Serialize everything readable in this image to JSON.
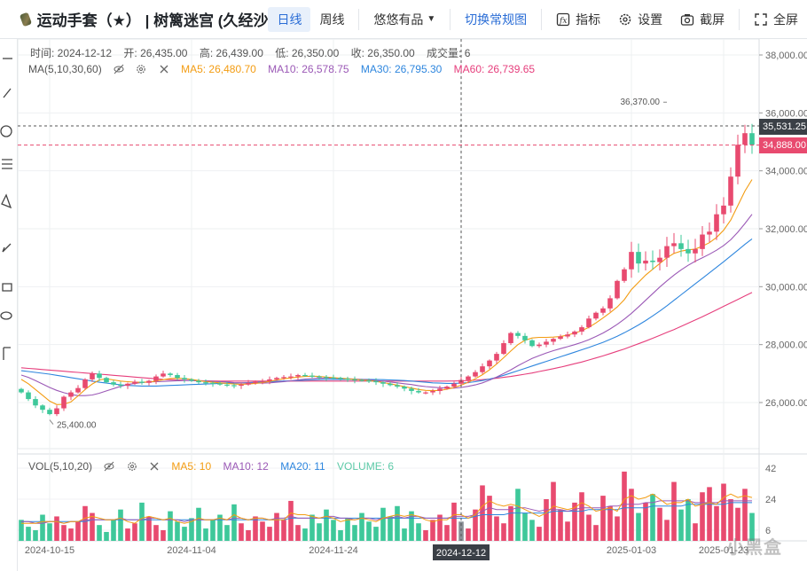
{
  "header": {
    "title": "运动手套（★） | 树篱迷宫 (久经沙",
    "tabs": [
      {
        "label": "日线",
        "active": true
      },
      {
        "label": "周线",
        "active": false
      }
    ],
    "filter_label": "悠悠有品",
    "switch_label": "切换常规图",
    "indicator_label": "指标",
    "settings_label": "设置",
    "screenshot_label": "截屏",
    "fullscreen_label": "全屏"
  },
  "info": {
    "time": "时间: 2024-12-12",
    "open": "开: 26,435.00",
    "high": "高: 26,439.00",
    "low": "低: 26,350.00",
    "close": "收: 26,350.00",
    "volume": "成交量: 6"
  },
  "ma_legend": {
    "name": "MA(5,10,30,60)",
    "ma5": "MA5: 26,480.70",
    "ma10": "MA10: 26,578.75",
    "ma30": "MA30: 26,795.30",
    "ma60": "MA60: 26,739.65"
  },
  "vol_legend": {
    "name": "VOL(5,10,20)",
    "ma5": "MA5: 10",
    "ma10": "MA10: 12",
    "ma20": "MA20: 11",
    "volume": "VOLUME: 6"
  },
  "price_tags": {
    "crosshair": "35,531.25",
    "last": "34,888.00"
  },
  "watermark": "小黑盒",
  "colors": {
    "up": "#e84a6f",
    "down": "#3ec89a",
    "ma5": "#f39c12",
    "ma10": "#9b59b6",
    "ma30": "#2e86de",
    "ma60": "#e63e7c"
  },
  "chart_data": [
    {
      "type": "candlestick",
      "title": "",
      "ylim": [
        24500,
        38500
      ],
      "y_ticks": [
        "38,000.00",
        "36,000.00",
        "34,000.00",
        "32,000.00",
        "30,000.00",
        "28,000.00",
        "26,000.00"
      ],
      "x_labels": [
        "2024-10-15",
        "2024-11-04",
        "2024-11-24",
        "2024-12-12",
        "2025-01-03",
        "2025-01-23"
      ],
      "crosshair_date": "2024-12-12",
      "annotations": [
        {
          "text": "36,370.00",
          "date_index": 91,
          "value": 36370
        },
        {
          "text": "25,400.00",
          "date_index": 4,
          "value": 25400
        }
      ],
      "close": [
        26350,
        26120,
        25900,
        25750,
        25600,
        25800,
        26200,
        26350,
        26500,
        26800,
        27000,
        26850,
        26700,
        26620,
        26580,
        26650,
        26720,
        26680,
        26750,
        26900,
        27000,
        26950,
        26850,
        26800,
        26750,
        26700,
        26680,
        26660,
        26620,
        26600,
        26580,
        26620,
        26680,
        26720,
        26750,
        26800,
        26850,
        26880,
        26900,
        26950,
        26930,
        26900,
        26880,
        26860,
        26850,
        26820,
        26800,
        26780,
        26760,
        26740,
        26700,
        26650,
        26600,
        26550,
        26480,
        26400,
        26350,
        26350,
        26400,
        26480,
        26550,
        26650,
        26780,
        26900,
        27050,
        27250,
        27450,
        27680,
        28050,
        28400,
        28300,
        28150,
        27950,
        28000,
        28100,
        28200,
        28280,
        28350,
        28450,
        28600,
        28900,
        29100,
        29250,
        29600,
        30200,
        30600,
        31200,
        30800,
        30900,
        30850,
        31000,
        31400,
        31500,
        31300,
        31150,
        31300,
        31800,
        31900,
        32500,
        32800,
        33800,
        34900,
        35300,
        34900
      ],
      "ma5": [
        26800,
        26650,
        26450,
        26250,
        26050,
        25930,
        25940,
        26020,
        26230,
        26450,
        26640,
        26780,
        26820,
        26780,
        26740,
        26720,
        26700,
        26700,
        26710,
        26740,
        26790,
        26830,
        26840,
        26830,
        26800,
        26760,
        26720,
        26700,
        26680,
        26660,
        26640,
        26630,
        26640,
        26660,
        26690,
        26730,
        26780,
        26820,
        26850,
        26880,
        26900,
        26910,
        26900,
        26880,
        26860,
        26840,
        26820,
        26800,
        26780,
        26760,
        26730,
        26690,
        26650,
        26600,
        26550,
        26500,
        26450,
        26420,
        26410,
        26420,
        26460,
        26520,
        26600,
        26700,
        26820,
        26960,
        27130,
        27330,
        27550,
        27780,
        28000,
        28150,
        28230,
        28250,
        28250,
        28260,
        28280,
        28330,
        28400,
        28480,
        28600,
        28750,
        28920,
        29100,
        29300,
        29550,
        29900,
        30150,
        30400,
        30600,
        30800,
        31000,
        31150,
        31230,
        31270,
        31300,
        31400,
        31520,
        31700,
        31950,
        32300,
        32800,
        33300,
        33700
      ],
      "ma10": [
        26950,
        26870,
        26760,
        26640,
        26520,
        26420,
        26340,
        26280,
        26240,
        26240,
        26260,
        26320,
        26400,
        26480,
        26560,
        26620,
        26660,
        26690,
        26710,
        26720,
        26730,
        26740,
        26750,
        26760,
        26760,
        26750,
        26740,
        26730,
        26720,
        26710,
        26690,
        26680,
        26670,
        26670,
        26670,
        26680,
        26700,
        26720,
        26750,
        26780,
        26810,
        26830,
        26840,
        26840,
        26840,
        26830,
        26820,
        26810,
        26800,
        26780,
        26760,
        26740,
        26710,
        26680,
        26650,
        26620,
        26580,
        26550,
        26530,
        26510,
        26500,
        26500,
        26520,
        26560,
        26610,
        26680,
        26770,
        26880,
        27000,
        27130,
        27270,
        27400,
        27520,
        27620,
        27710,
        27790,
        27860,
        27930,
        28000,
        28080,
        28170,
        28280,
        28400,
        28540,
        28700,
        28880,
        29080,
        29300,
        29530,
        29760,
        29990,
        30200,
        30400,
        30580,
        30740,
        30880,
        31000,
        31120,
        31260,
        31420,
        31620,
        31880,
        32180,
        32500
      ],
      "ma30": [
        27100,
        27070,
        27040,
        27010,
        26980,
        26940,
        26900,
        26860,
        26820,
        26780,
        26740,
        26700,
        26670,
        26640,
        26610,
        26590,
        26580,
        26570,
        26570,
        26570,
        26580,
        26590,
        26600,
        26610,
        26620,
        26630,
        26640,
        26650,
        26660,
        26670,
        26670,
        26680,
        26690,
        26700,
        26710,
        26720,
        26730,
        26740,
        26750,
        26760,
        26770,
        26780,
        26790,
        26795,
        26800,
        26800,
        26800,
        26800,
        26800,
        26800,
        26795,
        26790,
        26780,
        26770,
        26760,
        26740,
        26720,
        26700,
        26680,
        26670,
        26660,
        26660,
        26670,
        26690,
        26720,
        26760,
        26810,
        26870,
        26940,
        27020,
        27100,
        27180,
        27260,
        27340,
        27420,
        27500,
        27580,
        27660,
        27740,
        27820,
        27900,
        27990,
        28080,
        28180,
        28290,
        28410,
        28540,
        28680,
        28830,
        28990,
        29160,
        29340,
        29530,
        29720,
        29910,
        30100,
        30290,
        30480,
        30670,
        30860,
        31060,
        31260,
        31460,
        31650
      ],
      "ma60": [
        27200,
        27180,
        27160,
        27140,
        27120,
        27100,
        27080,
        27060,
        27040,
        27020,
        27000,
        26980,
        26960,
        26940,
        26920,
        26900,
        26880,
        26860,
        26840,
        26820,
        26800,
        26790,
        26780,
        26770,
        26760,
        26755,
        26750,
        26745,
        26740,
        26740,
        26740,
        26740,
        26740,
        26740,
        26740,
        26740,
        26740,
        26740,
        26740,
        26740,
        26740,
        26740,
        26740,
        26740,
        26740,
        26740,
        26740,
        26740,
        26740,
        26740,
        26740,
        26740,
        26740,
        26740,
        26740,
        26740,
        26740,
        26740,
        26740,
        26740,
        26740,
        26745,
        26750,
        26760,
        26770,
        26790,
        26810,
        26840,
        26870,
        26900,
        26940,
        26980,
        27020,
        27070,
        27120,
        27170,
        27220,
        27280,
        27340,
        27400,
        27470,
        27540,
        27610,
        27690,
        27770,
        27850,
        27940,
        28030,
        28120,
        28220,
        28320,
        28420,
        28520,
        28630,
        28740,
        28850,
        28960,
        29080,
        29200,
        29320,
        29440,
        29560,
        29680,
        29800
      ]
    },
    {
      "type": "bar",
      "title": "",
      "ylim": [
        0,
        48
      ],
      "y_ticks": [
        "42",
        "24",
        "6"
      ],
      "volume": [
        12,
        8,
        6,
        15,
        10,
        14,
        9,
        7,
        11,
        20,
        16,
        9,
        5,
        12,
        18,
        7,
        10,
        22,
        14,
        9,
        6,
        17,
        11,
        8,
        13,
        19,
        7,
        12,
        15,
        9,
        21,
        10,
        6,
        14,
        11,
        8,
        16,
        12,
        23,
        9,
        7,
        15,
        10,
        18,
        12,
        6,
        13,
        9,
        16,
        11,
        8,
        19,
        14,
        20,
        7,
        17,
        10,
        6,
        12,
        15,
        9,
        22,
        11,
        7,
        18,
        32,
        26,
        14,
        10,
        20,
        30,
        16,
        12,
        8,
        24,
        34,
        18,
        11,
        22,
        28,
        15,
        9,
        26,
        20,
        14,
        40,
        30,
        16,
        22,
        27,
        19,
        12,
        34,
        18,
        24,
        10,
        28,
        31,
        20,
        33,
        24,
        19,
        30,
        16
      ],
      "ma5": [
        10,
        10,
        10,
        11,
        11,
        11,
        10,
        11,
        11,
        13,
        14,
        13,
        12,
        12,
        13,
        11,
        10,
        13,
        14,
        13,
        12,
        13,
        11,
        10,
        11,
        13,
        12,
        12,
        13,
        12,
        15,
        13,
        12,
        13,
        13,
        12,
        12,
        12,
        16,
        15,
        15,
        14,
        13,
        14,
        13,
        11,
        12,
        12,
        13,
        12,
        11,
        13,
        14,
        15,
        14,
        15,
        14,
        12,
        11,
        12,
        12,
        15,
        15,
        13,
        15,
        20,
        23,
        21,
        20,
        21,
        20,
        18,
        16,
        14,
        16,
        20,
        19,
        18,
        19,
        22,
        20,
        17,
        18,
        19,
        17,
        24,
        26,
        24,
        25,
        27,
        24,
        21,
        22,
        22,
        24,
        20,
        21,
        22,
        21,
        25,
        27,
        25,
        26,
        25
      ],
      "ma10": [
        11,
        11,
        10,
        10,
        11,
        11,
        10,
        11,
        11,
        12,
        12,
        12,
        12,
        12,
        13,
        12,
        12,
        12,
        13,
        13,
        12,
        12,
        12,
        11,
        12,
        12,
        12,
        12,
        13,
        12,
        13,
        13,
        12,
        13,
        13,
        12,
        13,
        13,
        14,
        13,
        13,
        13,
        13,
        14,
        14,
        13,
        13,
        12,
        13,
        13,
        12,
        13,
        13,
        14,
        13,
        14,
        14,
        13,
        13,
        13,
        13,
        14,
        14,
        14,
        15,
        17,
        19,
        18,
        18,
        18,
        19,
        19,
        18,
        17,
        18,
        18,
        18,
        17,
        18,
        19,
        19,
        19,
        19,
        20,
        20,
        21,
        21,
        21,
        22,
        22,
        23,
        23,
        23,
        23,
        23,
        22,
        22,
        22,
        22,
        23,
        23,
        23,
        23,
        23
      ],
      "ma20": [
        11,
        11,
        11,
        11,
        11,
        11,
        11,
        11,
        11,
        11,
        12,
        12,
        12,
        12,
        12,
        12,
        12,
        12,
        12,
        12,
        12,
        12,
        12,
        12,
        12,
        12,
        12,
        12,
        12,
        12,
        12,
        12,
        12,
        12,
        12,
        12,
        12,
        12,
        13,
        13,
        13,
        13,
        13,
        13,
        13,
        13,
        13,
        13,
        13,
        13,
        13,
        13,
        13,
        13,
        13,
        13,
        13,
        13,
        13,
        13,
        13,
        13,
        13,
        13,
        14,
        15,
        15,
        15,
        15,
        16,
        16,
        16,
        16,
        16,
        16,
        17,
        17,
        17,
        17,
        17,
        18,
        18,
        18,
        18,
        18,
        19,
        19,
        19,
        19,
        20,
        20,
        20,
        20,
        20,
        21,
        21,
        21,
        21,
        21,
        21,
        22,
        22,
        22,
        22
      ]
    }
  ]
}
